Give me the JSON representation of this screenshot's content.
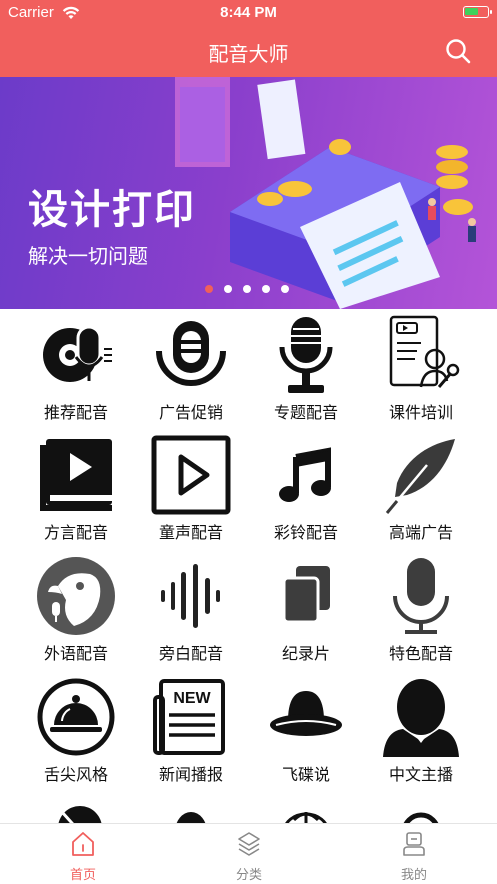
{
  "status_bar": {
    "carrier": "Carrier",
    "time": "8:44 PM"
  },
  "nav": {
    "title": "配音大师",
    "search_icon": "search-icon"
  },
  "banner": {
    "title": "设计打印",
    "subtitle": "解决一切问题",
    "dot_count": 5,
    "active_dot": 0
  },
  "categories": [
    {
      "label": "推荐配音",
      "icon": "vinyl-mic-icon"
    },
    {
      "label": "广告促销",
      "icon": "mic-capsule-icon"
    },
    {
      "label": "专题配音",
      "icon": "studio-mic-icon"
    },
    {
      "label": "课件培训",
      "icon": "courseware-icon"
    },
    {
      "label": "方言配音",
      "icon": "video-book-icon"
    },
    {
      "label": "童声配音",
      "icon": "play-box-icon"
    },
    {
      "label": "彩铃配音",
      "icon": "music-note-icon"
    },
    {
      "label": "高端广告",
      "icon": "feather-icon"
    },
    {
      "label": "外语配音",
      "icon": "parrot-icon"
    },
    {
      "label": "旁白配音",
      "icon": "sound-wave-icon"
    },
    {
      "label": "纪录片",
      "icon": "copy-icon"
    },
    {
      "label": "特色配音",
      "icon": "microphone-icon"
    },
    {
      "label": "舌尖风格",
      "icon": "food-cloche-icon"
    },
    {
      "label": "新闻播报",
      "icon": "newspaper-icon"
    },
    {
      "label": "飞碟说",
      "icon": "ufo-hat-icon"
    },
    {
      "label": "中文主播",
      "icon": "anchor-person-icon"
    }
  ],
  "tabs": [
    {
      "label": "首页",
      "icon": "home-icon",
      "active": true
    },
    {
      "label": "分类",
      "icon": "layers-icon",
      "active": false
    },
    {
      "label": "我的",
      "icon": "profile-icon",
      "active": false
    }
  ],
  "colors": {
    "brand": "#f15f5d",
    "icon": "#111111",
    "tab_inactive": "#888888"
  }
}
